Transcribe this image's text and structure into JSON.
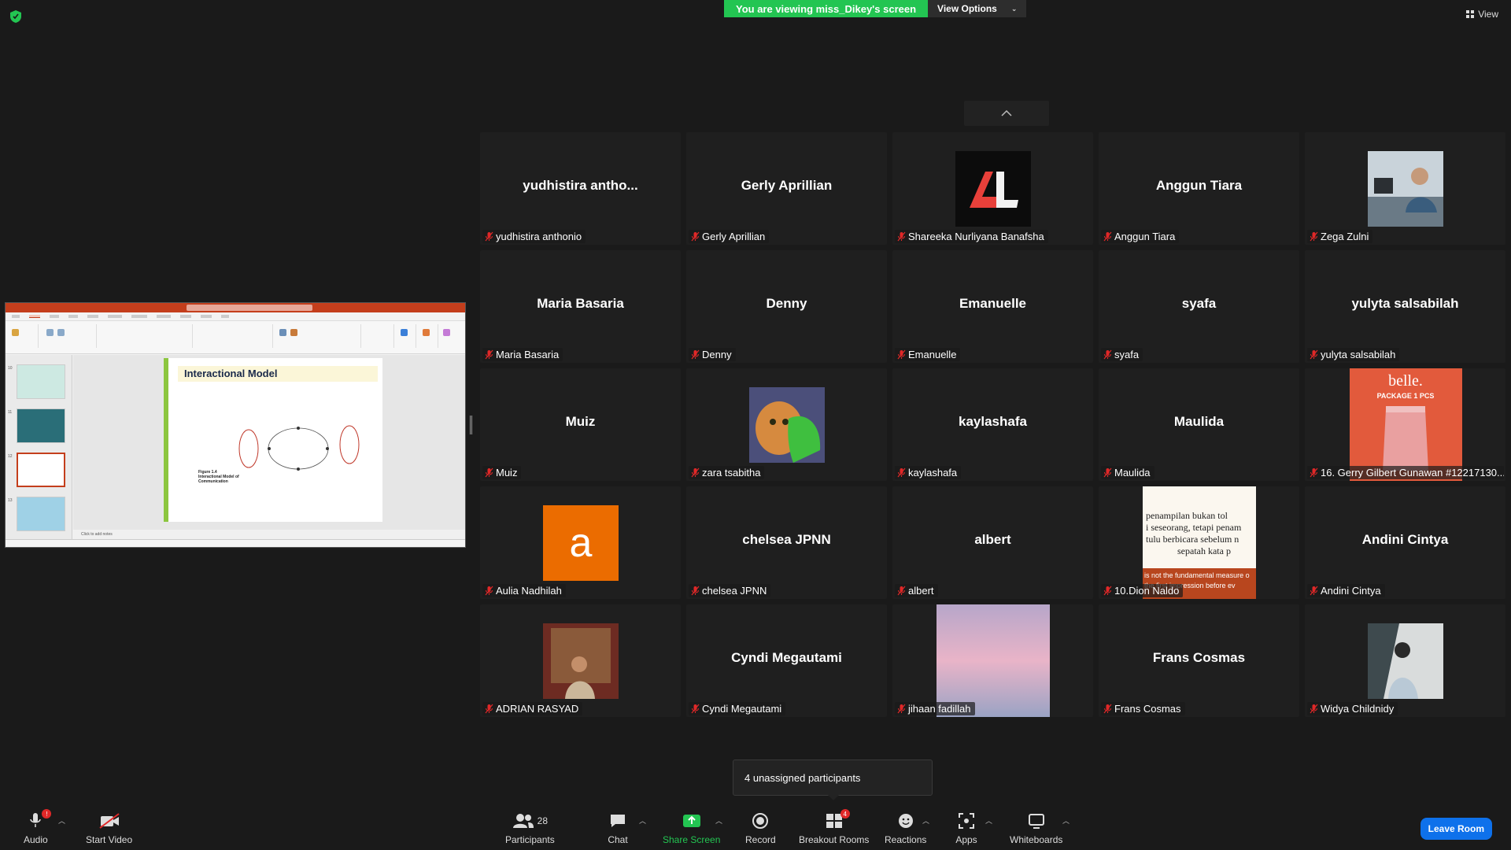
{
  "top": {
    "viewing_banner": "You are viewing miss_Dikey's screen",
    "view_options": "View Options",
    "view_label": "View"
  },
  "shared_screen": {
    "slide_title": "Interactional Model",
    "figure_caption_1": "Figure 1.4",
    "figure_caption_2": "Interactional Model of Communication",
    "notes_placeholder": "Click to add notes",
    "thumb_numbers": [
      "10",
      "11",
      "12",
      "13"
    ]
  },
  "gallery": [
    {
      "name": "yudhistira anthonio",
      "display": "yudhistira  antho...",
      "type": "name"
    },
    {
      "name": "Gerly Aprillian",
      "display": "Gerly Aprillian",
      "type": "name"
    },
    {
      "name": "Shareeka Nurliyana Banafsha",
      "display": "",
      "type": "logo"
    },
    {
      "name": "Anggun Tiara",
      "display": "Anggun Tiara",
      "type": "name"
    },
    {
      "name": "Zega Zulni",
      "display": "",
      "type": "photo-office"
    },
    {
      "name": "Maria Basaria",
      "display": "Maria Basaria",
      "type": "name"
    },
    {
      "name": "Denny",
      "display": "Denny",
      "type": "name"
    },
    {
      "name": "Emanuelle",
      "display": "Emanuelle",
      "type": "name"
    },
    {
      "name": "syafa",
      "display": "syafa",
      "type": "name"
    },
    {
      "name": "yulyta salsabilah",
      "display": "yulyta salsabilah",
      "type": "name"
    },
    {
      "name": "Muiz",
      "display": "Muiz",
      "type": "name"
    },
    {
      "name": "zara tsabitha",
      "display": "",
      "type": "photo-cat"
    },
    {
      "name": "kaylashafa",
      "display": "kaylashafa",
      "type": "name"
    },
    {
      "name": "Maulida",
      "display": "Maulida",
      "type": "name"
    },
    {
      "name": "16. Gerry Gilbert Gunawan #12217130...",
      "display": "",
      "type": "photo-belle"
    },
    {
      "name": "Aulia Nadhilah",
      "display": "",
      "type": "avatar-a"
    },
    {
      "name": "chelsea JPNN",
      "display": "chelsea JPNN",
      "type": "name"
    },
    {
      "name": "albert",
      "display": "albert",
      "type": "name"
    },
    {
      "name": "10.Dion Naldo",
      "display": "",
      "type": "photo-quote"
    },
    {
      "name": "Andini Cintya",
      "display": "Andini Cintya",
      "type": "name"
    },
    {
      "name": "ADRIAN RASYAD",
      "display": "",
      "type": "photo-man"
    },
    {
      "name": "Cyndi Megautami",
      "display": "Cyndi Megautami",
      "type": "name"
    },
    {
      "name": "jihaan fadillah",
      "display": "",
      "type": "photo-sky"
    },
    {
      "name": "Frans Cosmas",
      "display": "Frans Cosmas",
      "type": "name"
    },
    {
      "name": "Widya Childnidy",
      "display": "",
      "type": "photo-mirror"
    }
  ],
  "belle": {
    "brand": "belle.",
    "package": "PACKAGE 1 PCS"
  },
  "quote": {
    "line1": "penampilan bukan tol",
    "line2": "i seseorang, tetapi penam",
    "line3": "tulu berbicara sebelum n",
    "line4": "sepatah kata p",
    "en1": "is not the fundamental measure o",
    "en2": "the first impression before ev"
  },
  "avatar_letter": "a",
  "popup": {
    "text": "4 unassigned participants"
  },
  "toolbar": {
    "audio": "Audio",
    "audio_badge": "!",
    "start_video": "Start Video",
    "participants": "Participants",
    "participants_count": "28",
    "chat": "Chat",
    "share_screen": "Share Screen",
    "record": "Record",
    "breakout_rooms": "Breakout Rooms",
    "breakout_badge": "4",
    "reactions": "Reactions",
    "apps": "Apps",
    "whiteboards": "Whiteboards",
    "leave_room": "Leave Room"
  },
  "colors": {
    "banner_green": "#23c552",
    "share_green": "#23c552",
    "leave_blue": "#0e71eb",
    "mic_red": "#e02828",
    "tile_bg": "#1f1f1f"
  }
}
